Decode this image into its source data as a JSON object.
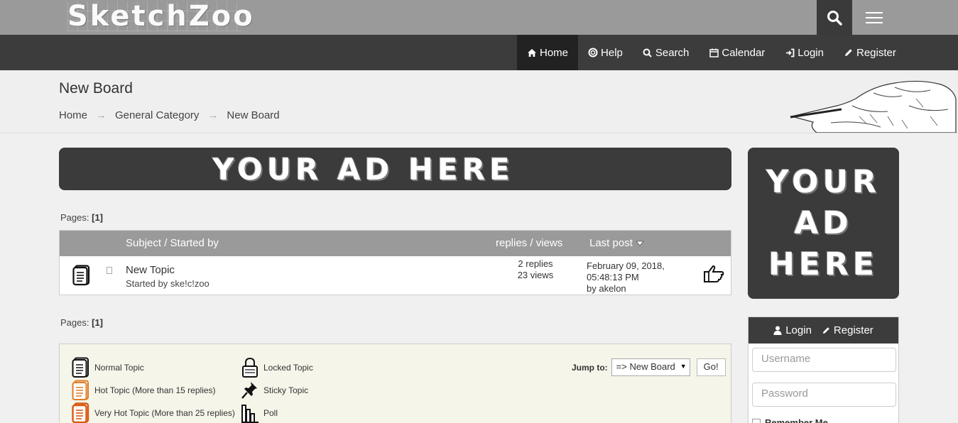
{
  "brand": {
    "logo": "SketchZoo"
  },
  "topbar": {
    "search_icon": "search-icon",
    "menu_icon": "hamburger-menu-icon"
  },
  "nav": {
    "items": [
      {
        "label": "Home",
        "icon": "home-icon",
        "active": true
      },
      {
        "label": "Help",
        "icon": "life-ring-icon"
      },
      {
        "label": "Search",
        "icon": "search-icon"
      },
      {
        "label": "Calendar",
        "icon": "calendar-icon"
      },
      {
        "label": "Login",
        "icon": "sign-in-icon"
      },
      {
        "label": "Register",
        "icon": "pencil-icon"
      }
    ]
  },
  "header": {
    "title": "New Board",
    "breadcrumb": [
      "Home",
      "General Category",
      "New Board"
    ]
  },
  "ads": {
    "wide": "YOUR AD HERE",
    "side": [
      "YOUR",
      "AD",
      "HERE"
    ]
  },
  "pagination": {
    "label": "Pages:",
    "current": "[1]"
  },
  "table": {
    "headers": {
      "subject": "Subject / Started by",
      "stats": "replies / views",
      "lastpost": "Last post"
    },
    "rows": [
      {
        "title": "New Topic",
        "started_by": "Started by ske!c!zoo",
        "replies": "2 replies",
        "views": "23 views",
        "last_post_date": "February 09, 2018, 05:48:13 PM",
        "last_post_by": "by akelon"
      }
    ]
  },
  "legend": {
    "items": [
      {
        "label": "Normal Topic",
        "icon": "normal-topic-icon"
      },
      {
        "label": "Hot Topic (More than 15 replies)",
        "icon": "hot-topic-icon"
      },
      {
        "label": "Very Hot Topic (More than 25 replies)",
        "icon": "very-hot-topic-icon"
      },
      {
        "label": "Locked Topic",
        "icon": "lock-icon"
      },
      {
        "label": "Sticky Topic",
        "icon": "pin-icon"
      },
      {
        "label": "Poll",
        "icon": "poll-icon"
      }
    ],
    "jump_label": "Jump to:",
    "jump_value": "=> New Board",
    "go_label": "Go!"
  },
  "login": {
    "login_label": "Login",
    "register_label": "Register",
    "username_placeholder": "Username",
    "password_placeholder": "Password",
    "remember_label": "Remember Me"
  },
  "colors": {
    "topbar": "#9a9a9a",
    "navbar": "#3c3c3c",
    "hot": "#e07b22",
    "very_hot": "#d85a12"
  }
}
